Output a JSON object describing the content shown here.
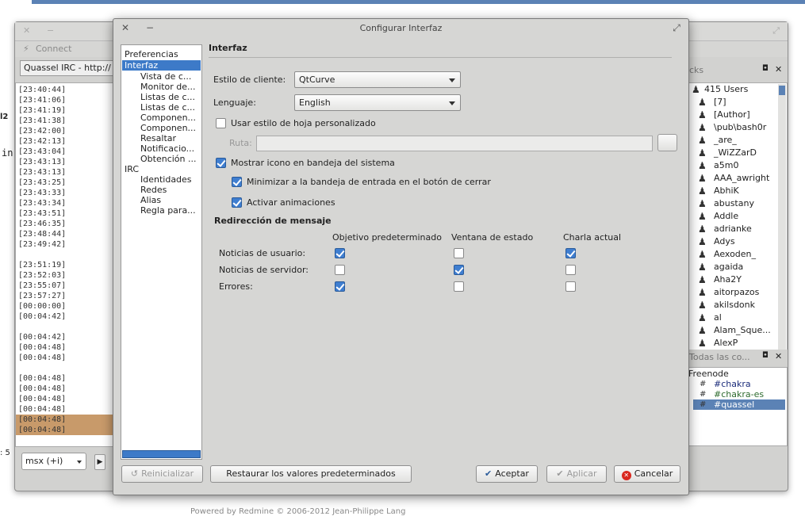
{
  "dialog": {
    "title": "Configurar Interfaz"
  },
  "tree": {
    "items": [
      {
        "label": "Preferencias"
      },
      {
        "label": "Interfaz"
      },
      {
        "label": "Vista de c..."
      },
      {
        "label": "Monitor de..."
      },
      {
        "label": "Listas de c..."
      },
      {
        "label": "Listas de c..."
      },
      {
        "label": "Componen..."
      },
      {
        "label": "Componen..."
      },
      {
        "label": "Resaltar"
      },
      {
        "label": "Notificacio..."
      },
      {
        "label": "Obtención ..."
      },
      {
        "label": "IRC"
      },
      {
        "label": "Identidades"
      },
      {
        "label": "Redes"
      },
      {
        "label": "Alias"
      },
      {
        "label": "Regla para..."
      }
    ]
  },
  "panel": {
    "title": "Interfaz",
    "client_style_label": "Estilo de cliente:",
    "client_style_value": "QtCurve",
    "language_label": "Lenguaje:",
    "language_value": "English",
    "custom_stylesheet_label": "Usar estilo de hoja personalizado",
    "custom_stylesheet_checked": false,
    "path_label": "Ruta:",
    "path_value": "",
    "tray_icon_label": "Mostrar icono en bandeja del sistema",
    "tray_icon_checked": true,
    "minimize_tray_label": "Minimizar a la bandeja de entrada en el botón de cerrar",
    "minimize_tray_checked": true,
    "animations_label": "Activar animaciones",
    "animations_checked": true,
    "redirect_title": "Redirección de mensaje",
    "col_default": "Objetivo predeterminado",
    "col_status": "Ventana de estado",
    "col_current": "Charla actual",
    "rows": [
      {
        "label": "Noticias de usuario:",
        "default": true,
        "status": false,
        "current": true
      },
      {
        "label": "Noticias de servidor:",
        "default": false,
        "status": true,
        "current": false
      },
      {
        "label": "Errores:",
        "default": true,
        "status": false,
        "current": false
      }
    ]
  },
  "buttons": {
    "reset": "Reinicializar",
    "restore_defaults": "Restaurar los valores predeterminados",
    "accept": "Aceptar",
    "apply": "Aplicar",
    "cancel": "Cancelar"
  },
  "background": {
    "toolbar_connect": "Connect",
    "tab_label": "Quassel IRC - http://",
    "timestamps": [
      "[23:40:44]",
      "[23:41:06]",
      "[23:41:19]",
      "[23:41:38]",
      "[23:42:00]",
      "[23:42:13]",
      "[23:43:04]",
      "[23:43:13]",
      "[23:43:13]",
      "[23:43:25]",
      "[23:43:33]",
      "[23:43:34]",
      "[23:43:51]",
      "[23:46:35]",
      "[23:48:44]",
      "[23:49:42]",
      "",
      "[23:51:19]",
      "[23:52:03]",
      "[23:55:07]",
      "[23:57:27]",
      "[00:00:00]",
      "[00:04:42]",
      "",
      "[00:04:42]",
      "[00:04:48]",
      "[00:04:48]",
      "",
      "[00:04:48]",
      "[00:04:48]",
      "[00:04:48]",
      "[00:04:48]",
      "[00:04:48]",
      "[00:04:48]"
    ],
    "nick_header": "cks",
    "users_count": "415 Users",
    "nicks": [
      "[7]",
      "[Author]",
      "\\pub\\bash0r",
      "_are_",
      "_WiZZarD",
      "a5m0",
      "AAA_awright",
      "AbhiK",
      "abustany",
      "Addle",
      "adrianke",
      "Adys",
      "Aexoden_",
      "agaida",
      "Aha2Y",
      "aitorpazos",
      "akilsdonk",
      "al",
      "Alam_Sque...",
      "AlexP"
    ],
    "chan_header": "Todas las co...",
    "network": "Freenode",
    "channels": [
      "#chakra",
      "#chakra-es",
      "#quassel"
    ],
    "input_value": "msx (+i)",
    "left_fragments": [
      "l2",
      "in",
      ": 5"
    ],
    "footer": "Powered by Redmine © 2006-2012 Jean-Philippe Lang"
  }
}
